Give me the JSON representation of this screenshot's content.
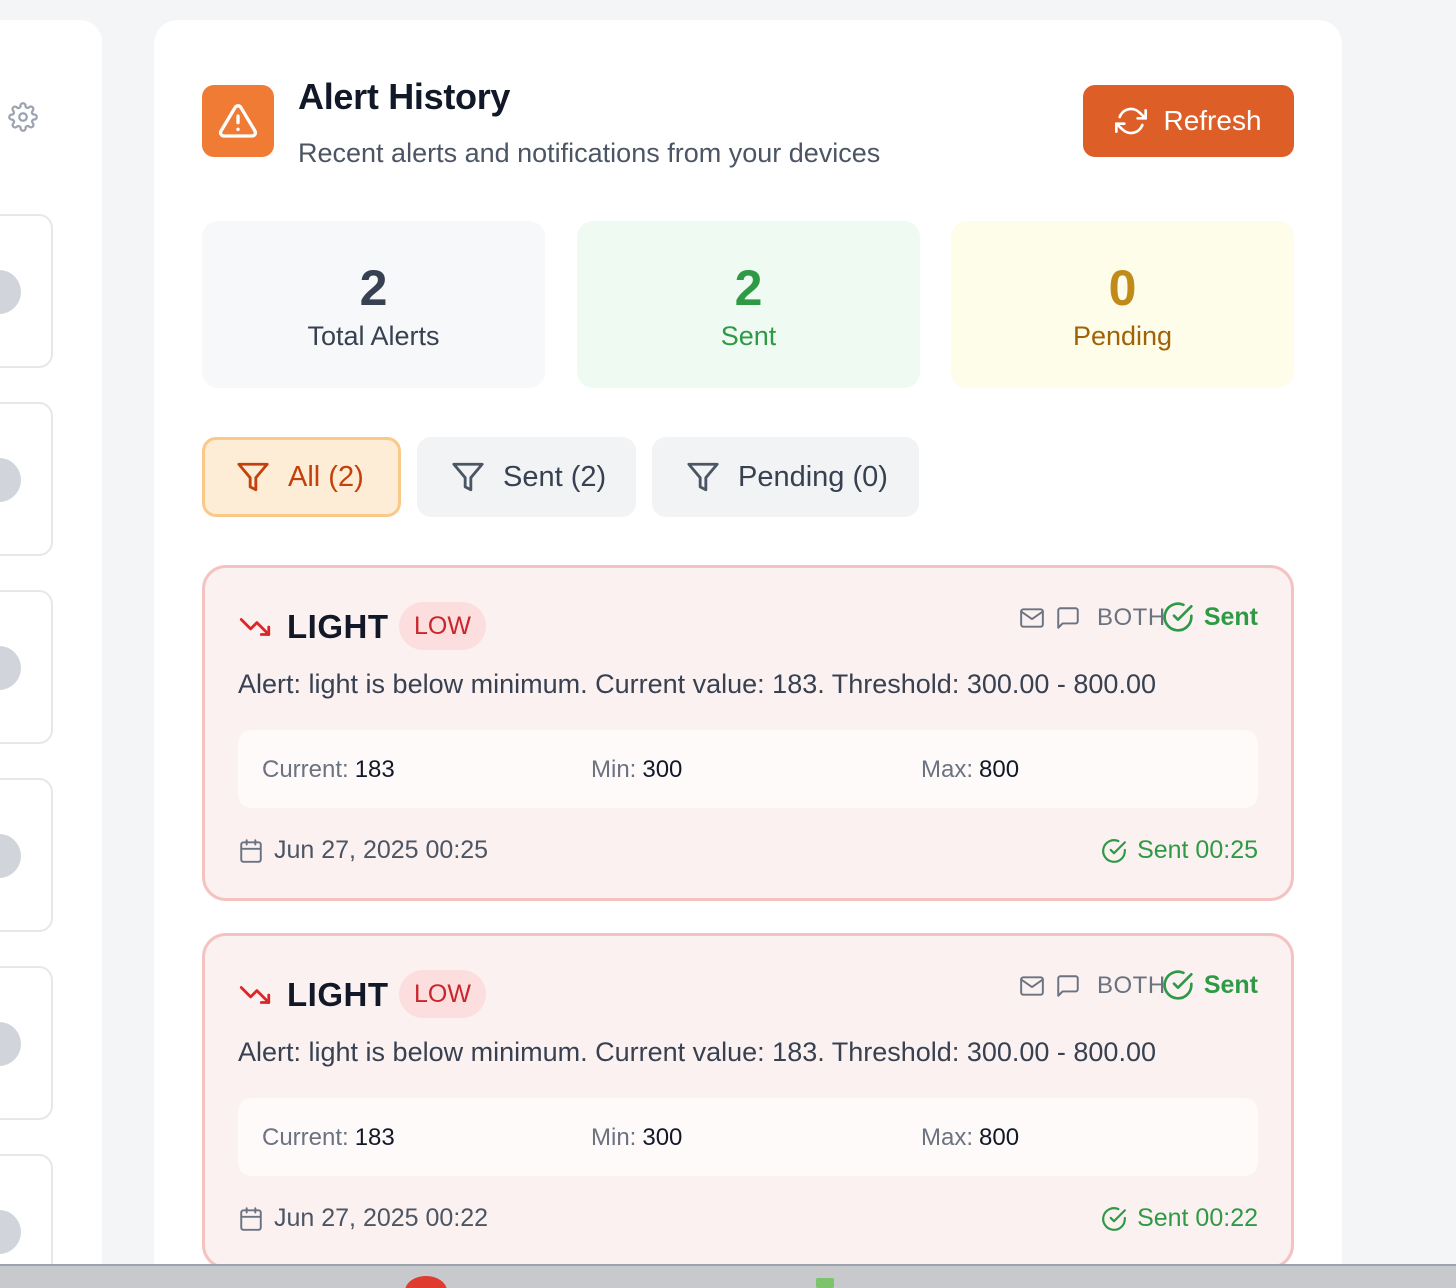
{
  "header": {
    "title": "Alert History",
    "subtitle": "Recent alerts and notifications from your devices",
    "refresh_label": "Refresh",
    "icon": "warning-triangle-icon"
  },
  "stats": {
    "total": {
      "value": "2",
      "label": "Total Alerts"
    },
    "sent": {
      "value": "2",
      "label": "Sent"
    },
    "pending": {
      "value": "0",
      "label": "Pending"
    }
  },
  "filters": [
    {
      "label": "All (2)",
      "active": true
    },
    {
      "label": "Sent (2)",
      "active": false
    },
    {
      "label": "Pending (0)",
      "active": false
    }
  ],
  "alerts": [
    {
      "sensor": "LIGHT",
      "level": "LOW",
      "channel": "BOTH",
      "status": "Sent",
      "message": "Alert: light is below minimum. Current value: 183. Threshold: 300.00 - 800.00",
      "current_label": "Current:",
      "current_value": "183",
      "min_label": "Min:",
      "min_value": "300",
      "max_label": "Max:",
      "max_value": "800",
      "date": "Jun 27, 2025 00:25",
      "sent_time": "Sent 00:25"
    },
    {
      "sensor": "LIGHT",
      "level": "LOW",
      "channel": "BOTH",
      "status": "Sent",
      "message": "Alert: light is below minimum. Current value: 183. Threshold: 300.00 - 800.00",
      "current_label": "Current:",
      "current_value": "183",
      "min_label": "Min:",
      "min_value": "300",
      "max_label": "Max:",
      "max_value": "800",
      "date": "Jun 27, 2025 00:22",
      "sent_time": "Sent 00:22"
    }
  ],
  "colors": {
    "accent": "#dd5e27",
    "sent_green": "#2f9a46",
    "pending_amber": "#c08b19",
    "low_red": "#c8262b"
  }
}
